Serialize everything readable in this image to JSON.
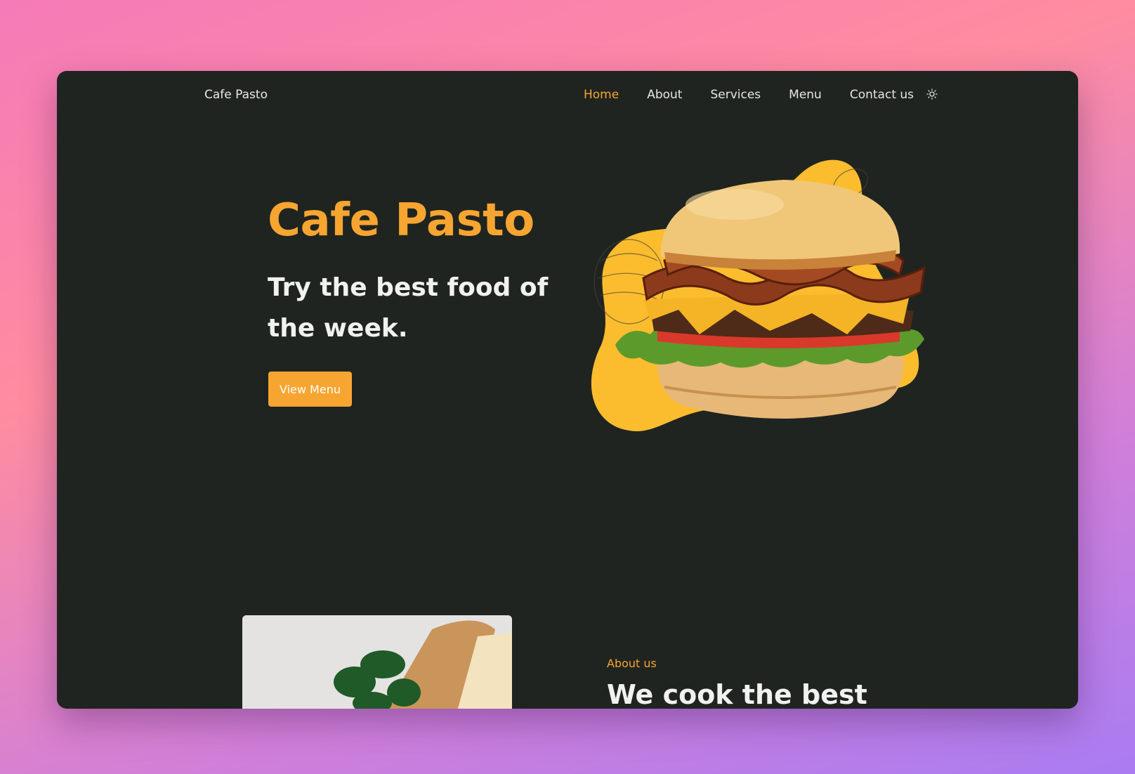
{
  "brand": "Cafe Pasto",
  "nav": {
    "items": [
      "Home",
      "About",
      "Services",
      "Menu",
      "Contact us"
    ],
    "active": "Home",
    "theme_icon": "sun-icon"
  },
  "hero": {
    "title": "Cafe Pasto",
    "subtitle": "Try the best food of the week.",
    "button_label": "View Menu"
  },
  "about": {
    "label": "About us",
    "title": "We cook the best"
  },
  "colors": {
    "accent": "#f7a531",
    "background": "#1f2420",
    "blob": "#fbbd2e"
  }
}
